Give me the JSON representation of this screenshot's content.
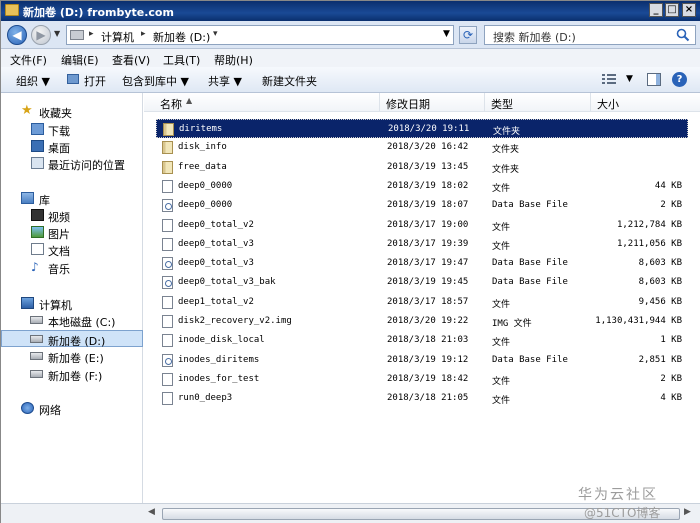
{
  "window": {
    "title": "新加卷 (D:) frombyte.com"
  },
  "address": {
    "crumbs": [
      "计算机",
      "新加卷 (D:)"
    ],
    "search_placeholder": "搜索 新加卷 (D:)"
  },
  "menu": [
    "文件(F)",
    "编辑(E)",
    "查看(V)",
    "工具(T)",
    "帮助(H)"
  ],
  "toolbar": {
    "organize": "组织 ▼",
    "open": "打开",
    "include_library": "包含到库中 ▼",
    "share": "共享 ▼",
    "new_folder": "新建文件夹"
  },
  "nav": {
    "favorites": {
      "label": "收藏夹",
      "items": [
        "下载",
        "桌面",
        "最近访问的位置"
      ]
    },
    "libraries": {
      "label": "库",
      "items": [
        "视频",
        "图片",
        "文档",
        "音乐"
      ]
    },
    "computer": {
      "label": "计算机",
      "items": [
        "本地磁盘 (C:)",
        "新加卷 (D:)",
        "新加卷 (E:)",
        "新加卷 (F:)"
      ]
    },
    "network": {
      "label": "网络"
    }
  },
  "columns": {
    "name": "名称",
    "date": "修改日期",
    "type": "类型",
    "size": "大小"
  },
  "files": [
    {
      "icon": "folder",
      "name": "diritems",
      "date": "2018/3/20 19:11",
      "type": "文件夹",
      "size": ""
    },
    {
      "icon": "folder",
      "name": "disk_info",
      "date": "2018/3/20 16:42",
      "type": "文件夹",
      "size": ""
    },
    {
      "icon": "folder",
      "name": "free_data",
      "date": "2018/3/19 13:45",
      "type": "文件夹",
      "size": ""
    },
    {
      "icon": "file",
      "name": "deep0_0000",
      "date": "2018/3/19 18:02",
      "type": "文件",
      "size": "44 KB"
    },
    {
      "icon": "db",
      "name": "deep0_0000",
      "date": "2018/3/19 18:07",
      "type": "Data Base File",
      "size": "2 KB"
    },
    {
      "icon": "file",
      "name": "deep0_total_v2",
      "date": "2018/3/17 19:00",
      "type": "文件",
      "size": "1,212,784 KB"
    },
    {
      "icon": "file",
      "name": "deep0_total_v3",
      "date": "2018/3/17 19:39",
      "type": "文件",
      "size": "1,211,056 KB"
    },
    {
      "icon": "db",
      "name": "deep0_total_v3",
      "date": "2018/3/17 19:47",
      "type": "Data Base File",
      "size": "8,603 KB"
    },
    {
      "icon": "db",
      "name": "deep0_total_v3_bak",
      "date": "2018/3/19 19:45",
      "type": "Data Base File",
      "size": "8,603 KB"
    },
    {
      "icon": "file",
      "name": "deep1_total_v2",
      "date": "2018/3/17 18:57",
      "type": "文件",
      "size": "9,456 KB"
    },
    {
      "icon": "file",
      "name": "disk2_recovery_v2.img",
      "date": "2018/3/20 19:22",
      "type": "IMG 文件",
      "size": "1,130,431,944 KB"
    },
    {
      "icon": "file",
      "name": "inode_disk_local",
      "date": "2018/3/18 21:03",
      "type": "文件",
      "size": "1 KB"
    },
    {
      "icon": "db",
      "name": "inodes_diritems",
      "date": "2018/3/19 19:12",
      "type": "Data Base File",
      "size": "2,851 KB"
    },
    {
      "icon": "file",
      "name": "inodes_for_test",
      "date": "2018/3/19 18:42",
      "type": "文件",
      "size": "2 KB"
    },
    {
      "icon": "file",
      "name": "run0_deep3",
      "date": "2018/3/18 21:05",
      "type": "文件",
      "size": "4 KB"
    }
  ],
  "watermark": {
    "line1": "华为云社区",
    "line2": "@51CTO博客"
  }
}
